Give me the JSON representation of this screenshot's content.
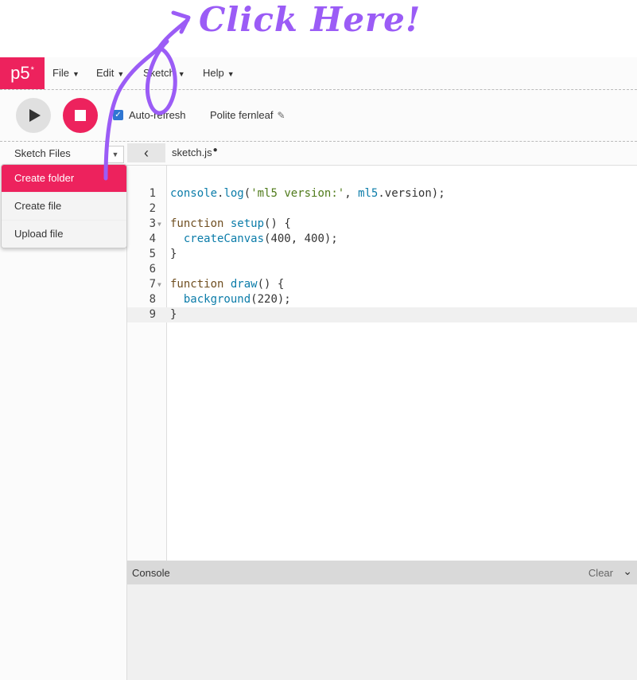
{
  "annotation": {
    "text": "Click Here!"
  },
  "menubar": {
    "logo": "p5",
    "logo_sup": "*",
    "items": [
      {
        "label": "File"
      },
      {
        "label": "Edit"
      },
      {
        "label": "Sketch"
      },
      {
        "label": "Help"
      }
    ]
  },
  "toolbar": {
    "auto_refresh_label": "Auto-refresh",
    "auto_refresh_checked": true,
    "sketch_name": "Polite fernleaf"
  },
  "sidebar": {
    "title": "Sketch Files",
    "dropdown": [
      {
        "label": "Create folder",
        "active": true
      },
      {
        "label": "Create file",
        "active": false
      },
      {
        "label": "Upload file",
        "active": false
      }
    ]
  },
  "editor": {
    "tab_name": "sketch.js",
    "unsaved_marker": "●",
    "lines": [
      "console.log('ml5 version:', ml5.version);",
      "",
      "function setup() {",
      "  createCanvas(400, 400);",
      "}",
      "",
      "function draw() {",
      "  background(220);",
      "}"
    ]
  },
  "console": {
    "title": "Console",
    "clear_label": "Clear"
  },
  "colors": {
    "accent": "#ed225d",
    "annotation": "#9b5cf6",
    "checkbox": "#2f76d2"
  }
}
